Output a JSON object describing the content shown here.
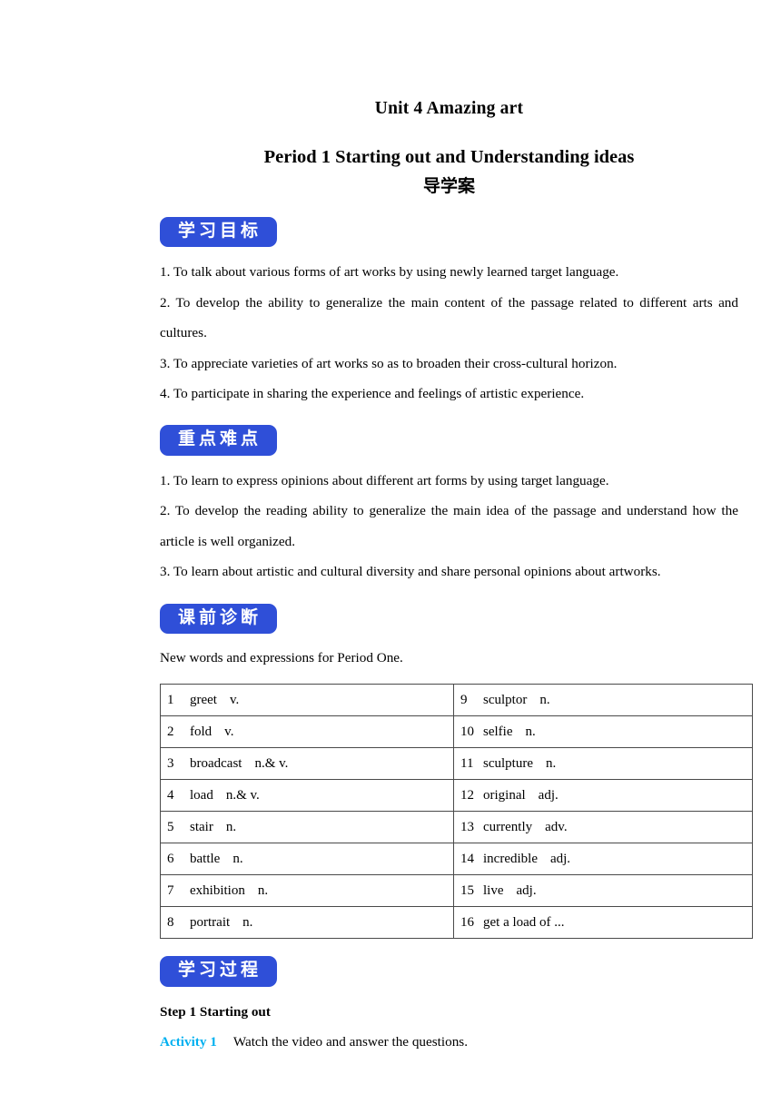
{
  "document": {
    "title": "Unit 4 Amazing art",
    "subtitle": "Period 1 Starting out and Understanding ideas",
    "subtitle_cn": "导学案"
  },
  "colors": {
    "badge_blue": "#2f4fd8",
    "activity_cyan": "#00b0f0",
    "table_border": "#4a4a4a",
    "text": "#000000"
  },
  "sections": {
    "objectives": {
      "badge": "学习目标",
      "items": [
        "1. To talk about various forms of art works by using newly learned target language.",
        "2. To develop the ability to generalize the main content of the passage related to different arts and cultures.",
        "3. To appreciate varieties of art works so as to broaden their cross-cultural horizon.",
        "4. To participate in sharing the experience and feelings of artistic experience."
      ]
    },
    "key_points": {
      "badge": "重点难点",
      "items": [
        "1. To learn to express opinions about different art forms by using target language.",
        "2. To develop the reading ability to generalize the main idea of the passage and understand how the article is well organized.",
        "3. To learn about artistic and cultural diversity and share personal opinions about artworks."
      ]
    },
    "pre_class": {
      "badge": "课前诊断",
      "intro": "New words and expressions for Period One.",
      "vocabulary": [
        {
          "left_no": "1",
          "left_word": "greet",
          "left_pos": "v.",
          "right_no": "9",
          "right_word": "sculptor",
          "right_pos": "n."
        },
        {
          "left_no": "2",
          "left_word": "fold",
          "left_pos": "v.",
          "right_no": "10",
          "right_word": "selfie",
          "right_pos": "n."
        },
        {
          "left_no": "3",
          "left_word": "broadcast",
          "left_pos": "n.& v.",
          "right_no": "11",
          "right_word": "sculpture",
          "right_pos": "n."
        },
        {
          "left_no": "4",
          "left_word": "load",
          "left_pos": "n.& v.",
          "right_no": "12",
          "right_word": "original",
          "right_pos": "adj."
        },
        {
          "left_no": "5",
          "left_word": "stair",
          "left_pos": "n.",
          "right_no": "13",
          "right_word": "currently",
          "right_pos": "adv."
        },
        {
          "left_no": "6",
          "left_word": "battle",
          "left_pos": "n.",
          "right_no": "14",
          "right_word": "incredible",
          "right_pos": "adj."
        },
        {
          "left_no": "7",
          "left_word": "exhibition",
          "left_pos": "n.",
          "right_no": "15",
          "right_word": "live",
          "right_pos": "adj."
        },
        {
          "left_no": "8",
          "left_word": "portrait",
          "left_pos": "n.",
          "right_no": "16",
          "right_word": "get a load of ...",
          "right_pos": ""
        }
      ]
    },
    "learning_process": {
      "badge": "学习过程",
      "step_title": "Step 1 Starting out",
      "activity_tag": "Activity 1",
      "activity_text": "Watch the video and answer the questions."
    }
  }
}
